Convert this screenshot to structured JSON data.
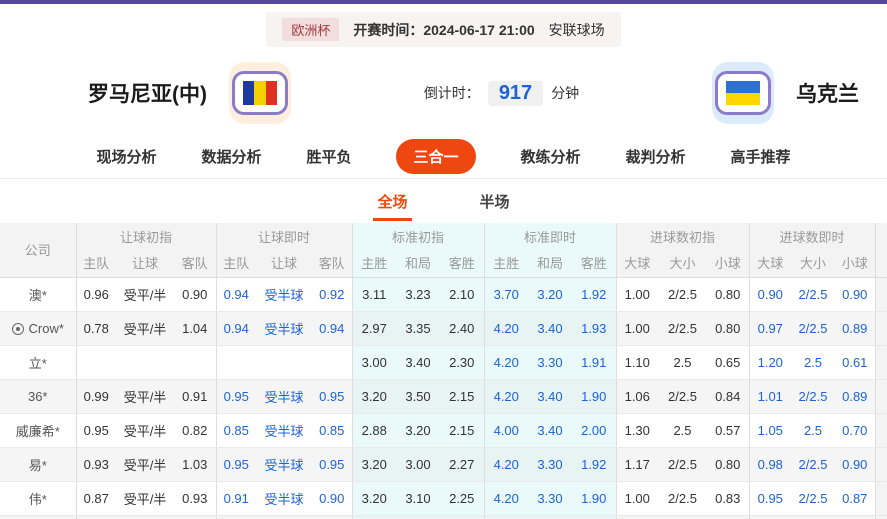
{
  "match_bar": {
    "league": "欧洲杯",
    "kickoff": "开赛时间：2024-06-17 21:00",
    "venue": "安联球场"
  },
  "header": {
    "home_team": "罗马尼亚(中)",
    "away_team": "乌克兰",
    "home_flag_icon": "romania-flag",
    "away_flag_icon": "ukraine-flag",
    "countdown_label": "倒计时：",
    "countdown_value": "917",
    "countdown_unit": "分钟"
  },
  "nav_tabs": [
    {
      "label": "现场分析",
      "active": false
    },
    {
      "label": "数据分析",
      "active": false
    },
    {
      "label": "胜平负",
      "active": false
    },
    {
      "label": "三合一",
      "active": true
    },
    {
      "label": "教练分析",
      "active": false
    },
    {
      "label": "裁判分析",
      "active": false
    },
    {
      "label": "高手推荐",
      "active": false
    }
  ],
  "sub_tabs": [
    {
      "label": "全场",
      "active": true
    },
    {
      "label": "半场",
      "active": false
    }
  ],
  "odds_table": {
    "company_header": "公司",
    "groups": [
      {
        "label": "让球初指",
        "cols": [
          "主队",
          "让球",
          "客队"
        ],
        "live": false,
        "tint": false
      },
      {
        "label": "让球即时",
        "cols": [
          "主队",
          "让球",
          "客队"
        ],
        "live": true,
        "tint": false
      },
      {
        "label": "标准初指",
        "cols": [
          "主胜",
          "和局",
          "客胜"
        ],
        "live": false,
        "tint": true
      },
      {
        "label": "标准即时",
        "cols": [
          "主胜",
          "和局",
          "客胜"
        ],
        "live": true,
        "tint": true
      },
      {
        "label": "进球数初指",
        "cols": [
          "大球",
          "大小",
          "小球"
        ],
        "live": false,
        "tint": false
      },
      {
        "label": "进球数即时",
        "cols": [
          "大球",
          "大小",
          "小球"
        ],
        "live": true,
        "tint": false
      }
    ],
    "rows": [
      {
        "company": "澳*",
        "has_icon": false,
        "cells": [
          "0.96",
          "受平/半",
          "0.90",
          "0.94",
          "受半球",
          "0.92",
          "3.11",
          "3.23",
          "2.10",
          "3.70",
          "3.20",
          "1.92",
          "1.00",
          "2/2.5",
          "0.80",
          "0.90",
          "2/2.5",
          "0.90"
        ]
      },
      {
        "company": "Crow*",
        "has_icon": true,
        "cells": [
          "0.78",
          "受平/半",
          "1.04",
          "0.94",
          "受半球",
          "0.94",
          "2.97",
          "3.35",
          "2.40",
          "4.20",
          "3.40",
          "1.93",
          "1.00",
          "2/2.5",
          "0.80",
          "0.97",
          "2/2.5",
          "0.89"
        ]
      },
      {
        "company": "立*",
        "has_icon": false,
        "cells": [
          "",
          "",
          "",
          "",
          "",
          "",
          "3.00",
          "3.40",
          "2.30",
          "4.20",
          "3.30",
          "1.91",
          "1.10",
          "2.5",
          "0.65",
          "1.20",
          "2.5",
          "0.61"
        ]
      },
      {
        "company": "36*",
        "has_icon": false,
        "cells": [
          "0.99",
          "受平/半",
          "0.91",
          "0.95",
          "受半球",
          "0.95",
          "3.20",
          "3.50",
          "2.15",
          "4.20",
          "3.40",
          "1.90",
          "1.06",
          "2/2.5",
          "0.84",
          "1.01",
          "2/2.5",
          "0.89"
        ]
      },
      {
        "company": "威廉希*",
        "has_icon": false,
        "cells": [
          "0.95",
          "受平/半",
          "0.82",
          "0.85",
          "受半球",
          "0.85",
          "2.88",
          "3.20",
          "2.15",
          "4.00",
          "3.40",
          "2.00",
          "1.30",
          "2.5",
          "0.57",
          "1.05",
          "2.5",
          "0.70"
        ]
      },
      {
        "company": "易*",
        "has_icon": false,
        "cells": [
          "0.93",
          "受平/半",
          "1.03",
          "0.95",
          "受半球",
          "0.95",
          "3.20",
          "3.00",
          "2.27",
          "4.20",
          "3.30",
          "1.92",
          "1.17",
          "2/2.5",
          "0.80",
          "0.98",
          "2/2.5",
          "0.90"
        ]
      },
      {
        "company": "伟*",
        "has_icon": false,
        "cells": [
          "0.87",
          "受平/半",
          "0.93",
          "0.91",
          "受半球",
          "0.90",
          "3.20",
          "3.10",
          "2.25",
          "4.20",
          "3.30",
          "1.90",
          "1.00",
          "2/2.5",
          "0.83",
          "0.95",
          "2/2.5",
          "0.87"
        ]
      }
    ]
  },
  "colors": {
    "top_bar": "#55489d",
    "accent_orange": "#ee4710",
    "live_blue": "#1c63d5",
    "standard_tint": "#eafafa",
    "league_badge_bg": "#f3dede",
    "league_badge_text": "#a03a40"
  }
}
